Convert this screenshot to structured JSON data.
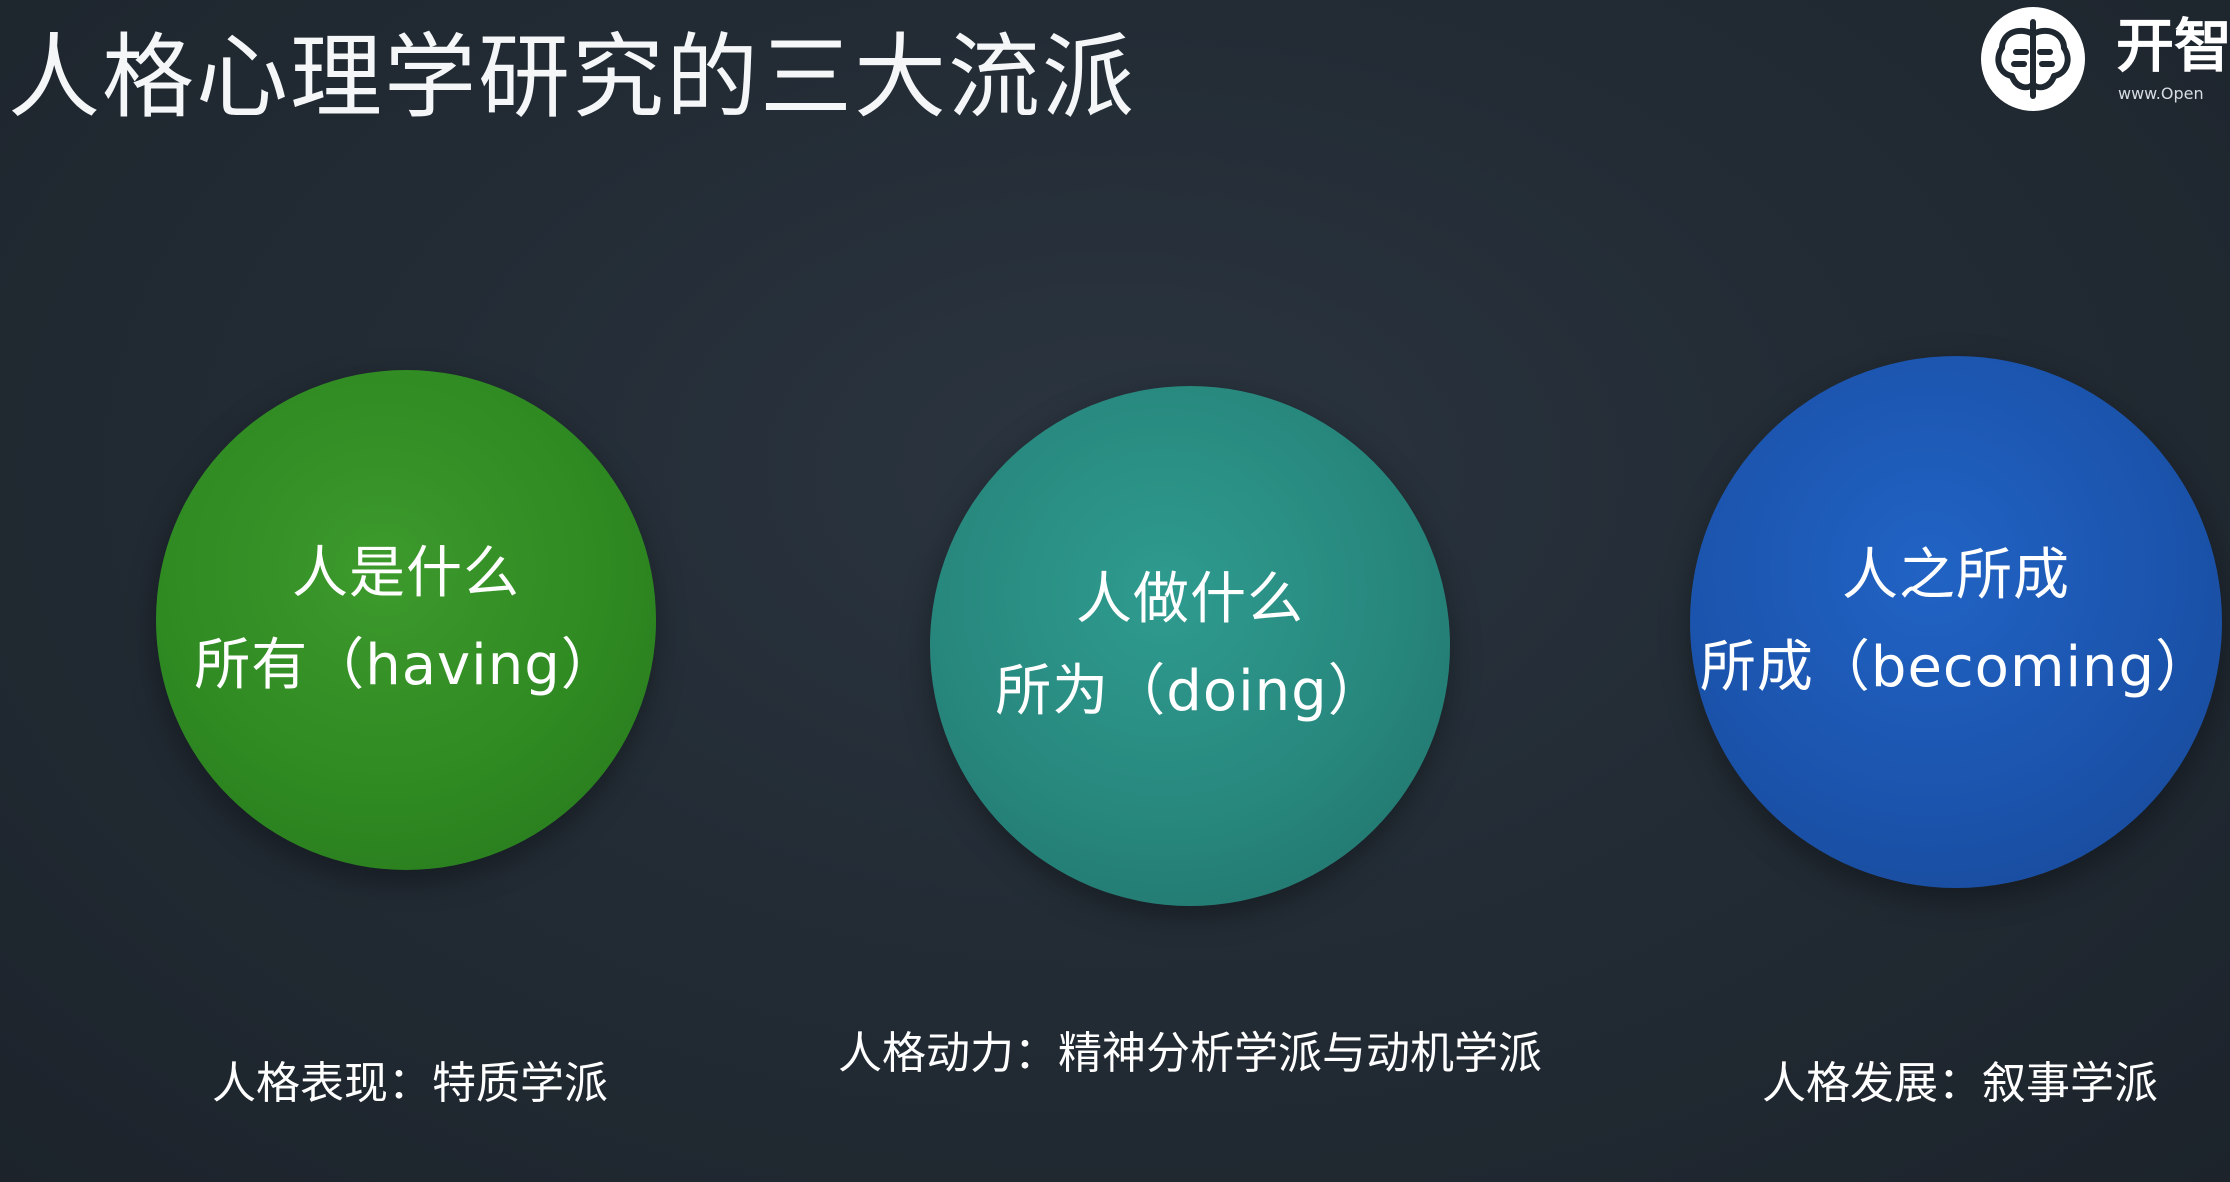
{
  "slide": {
    "title": "人格心理学研究的三大流派"
  },
  "logo": {
    "name": "开智",
    "url": "www.Open"
  },
  "schools": [
    {
      "line1": "人是什么",
      "line2": "所有（having）",
      "caption": "人格表现：特质学派",
      "color": "#2f8a22"
    },
    {
      "line1": "人做什么",
      "line2": "所为（doing）",
      "caption": "人格动力：精神分析学派与动机学派",
      "color": "#27877d"
    },
    {
      "line1": "人之所成",
      "line2": "所成（becoming）",
      "caption": "人格发展：叙事学派",
      "color": "#1b54ad"
    }
  ]
}
